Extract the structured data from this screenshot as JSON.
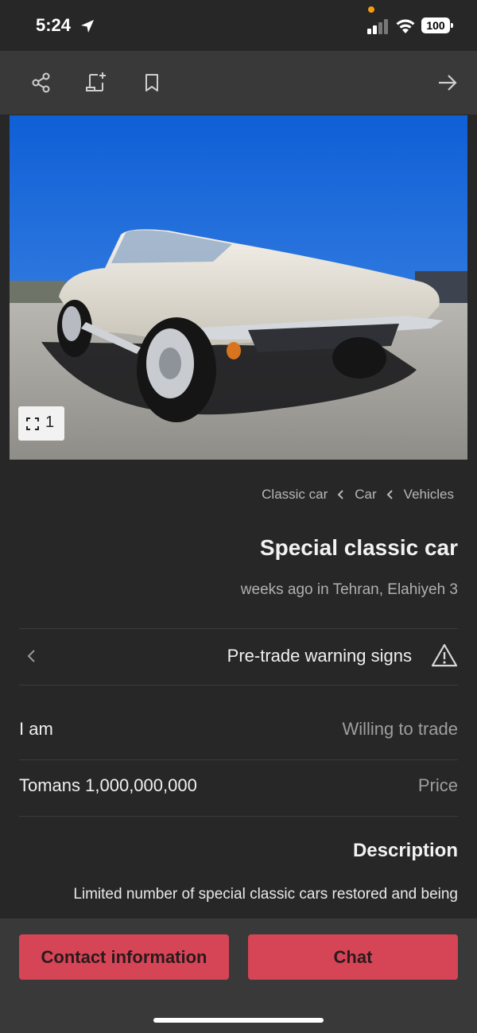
{
  "status_bar": {
    "time": "5:24",
    "battery": "100"
  },
  "toolbar": {
    "icons": [
      "share-icon",
      "add-note-icon",
      "bookmark-icon",
      "arrow-right-icon"
    ]
  },
  "gallery": {
    "image_count": "1"
  },
  "breadcrumb": [
    "Classic car",
    "Car",
    "Vehicles"
  ],
  "listing": {
    "title": "Special classic car",
    "meta": "weeks ago in Tehran, Elahiyeh 3"
  },
  "warning": {
    "label": "Pre-trade warning signs"
  },
  "details": [
    {
      "value": "I am",
      "label": "Willing to trade"
    },
    {
      "value": "Tomans 1,000,000,000",
      "label": "Price"
    }
  ],
  "description": {
    "title": "Description",
    "text": "Limited number of special classic cars restored and being"
  },
  "actions": {
    "contact_label": "Contact information",
    "chat_label": "Chat"
  },
  "colors": {
    "accent": "#d64556",
    "background": "#272727",
    "bar": "#393939"
  }
}
